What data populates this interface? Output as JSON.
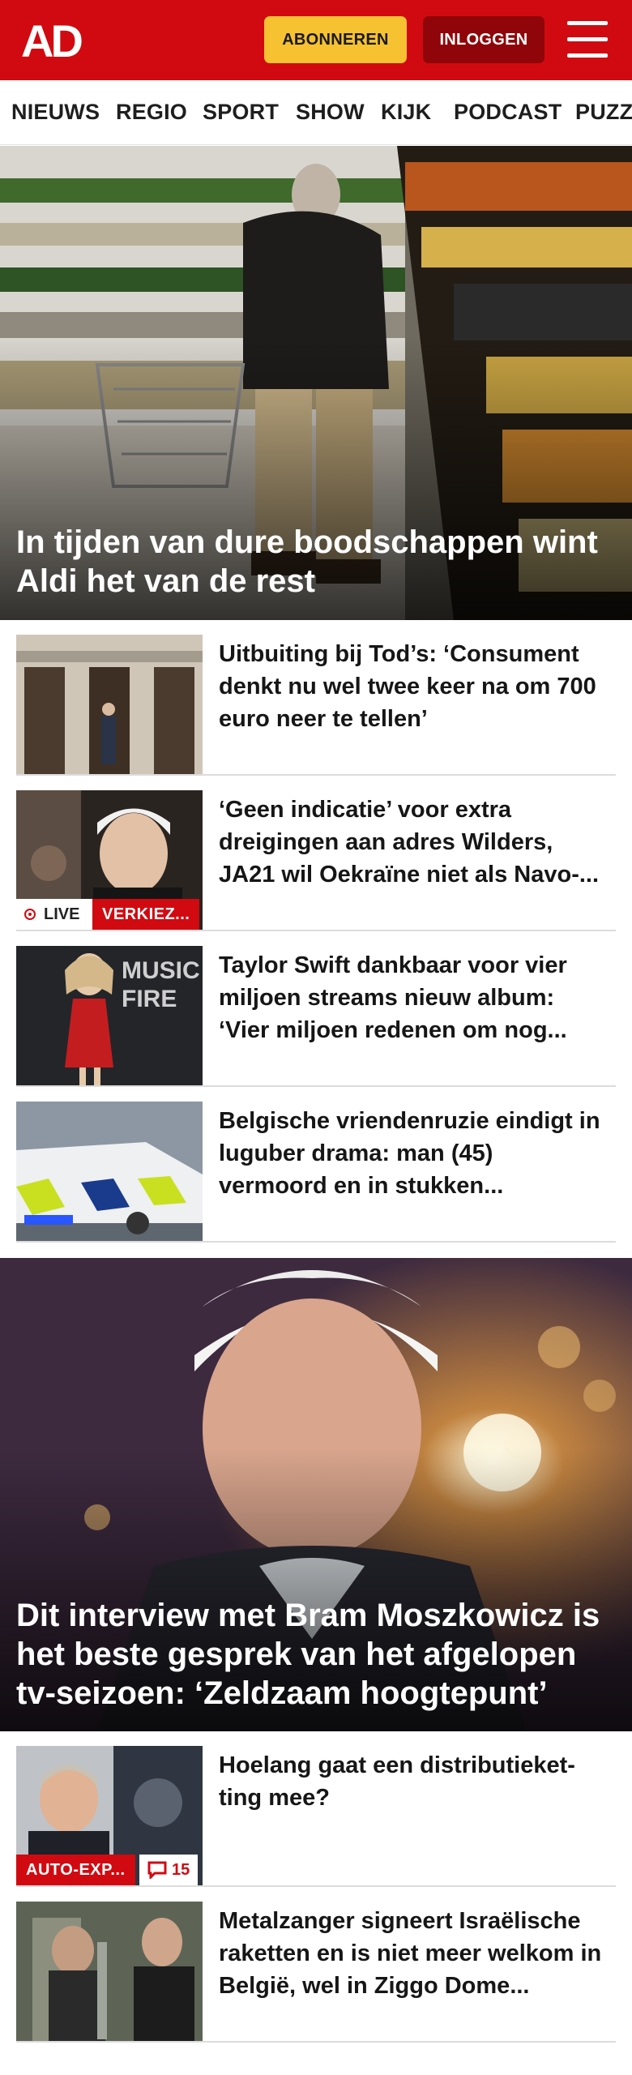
{
  "header": {
    "logo_alt": "AD",
    "subscribe_label": "ABONNEREN",
    "login_label": "INLOGGEN",
    "menu_icon": "hamburger-icon",
    "brand_color": "#d10a11",
    "subscribe_color": "#f7c232"
  },
  "nav": {
    "items": [
      {
        "label": "NIEUWS"
      },
      {
        "label": "REGIO"
      },
      {
        "label": "SPORT"
      },
      {
        "label": "SHOW"
      },
      {
        "label": "KIJK"
      },
      {
        "label": "PODCAST"
      },
      {
        "label": "PUZZ"
      }
    ]
  },
  "hero1": {
    "title": "In tijden van dure boodschappen wint Aldi het van de rest"
  },
  "articles_group1": [
    {
      "title": "Uitbuiting bij Tod’s: ‘Consument denkt nu wel twee keer na om 700 euro neer te tellen’"
    },
    {
      "title": "‘Geen indicatie’ voor extra dreigingen aan adres Wilders, JA21 wil Oekraïne niet als Navo-...",
      "live_label": "LIVE",
      "tag": "VERKIEZ..."
    },
    {
      "title": "Taylor Swift dankbaar voor vier miljoen streams nieuw album: ‘Vier miljoen redenen om nog..."
    },
    {
      "title": "Belgische vriendenruzie eindigt in luguber drama: man (45) vermoord en in stukken..."
    }
  ],
  "hero2": {
    "title": "Dit interview met Bram Moszkowicz is het beste gesprek van het afgelopen tv-seizoen: ‘Zeldzaam hoogtepunt’"
  },
  "articles_group2": [
    {
      "title": "Hoelang gaat een distributieket-ting mee?",
      "tag": "AUTO-EXP...",
      "comments": "15"
    },
    {
      "title": "Metalzanger signeert Israëlische raketten en is niet meer welkom in België, wel in Ziggo Dome..."
    }
  ]
}
